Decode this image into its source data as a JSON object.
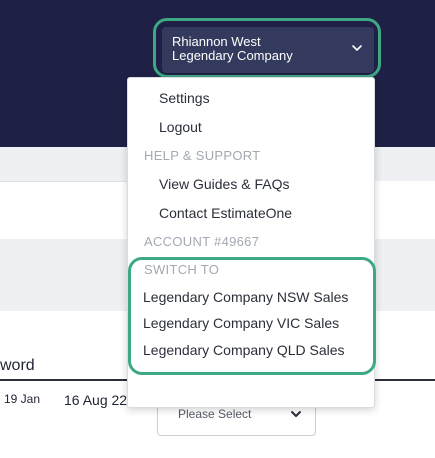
{
  "colors": {
    "header_bg": "#1e2145",
    "account_button_bg": "#333a5e",
    "highlight_ring": "#3ea784",
    "section_label": "#a3a8b1"
  },
  "account": {
    "name": "Rhiannon West",
    "company": "Legendary Company",
    "chevron_icon": "chevron-down-icon"
  },
  "menu": {
    "items": {
      "settings": "Settings",
      "logout": "Logout"
    },
    "help_section": "HELP & SUPPORT",
    "help_items": {
      "guides": "View Guides & FAQs",
      "contact": "Contact EstimateOne"
    },
    "account_number": "ACCOUNT #49667",
    "switch_section": "SWITCH TO",
    "switch_items": [
      "Legendary Company NSW Sales",
      "Legendary Company VIC Sales",
      "Legendary Company QLD Sales"
    ]
  },
  "background_page": {
    "column_header": "word",
    "date_1": "19 Jan",
    "date_2": "16 Aug 22",
    "select_placeholder": "Please Select"
  }
}
